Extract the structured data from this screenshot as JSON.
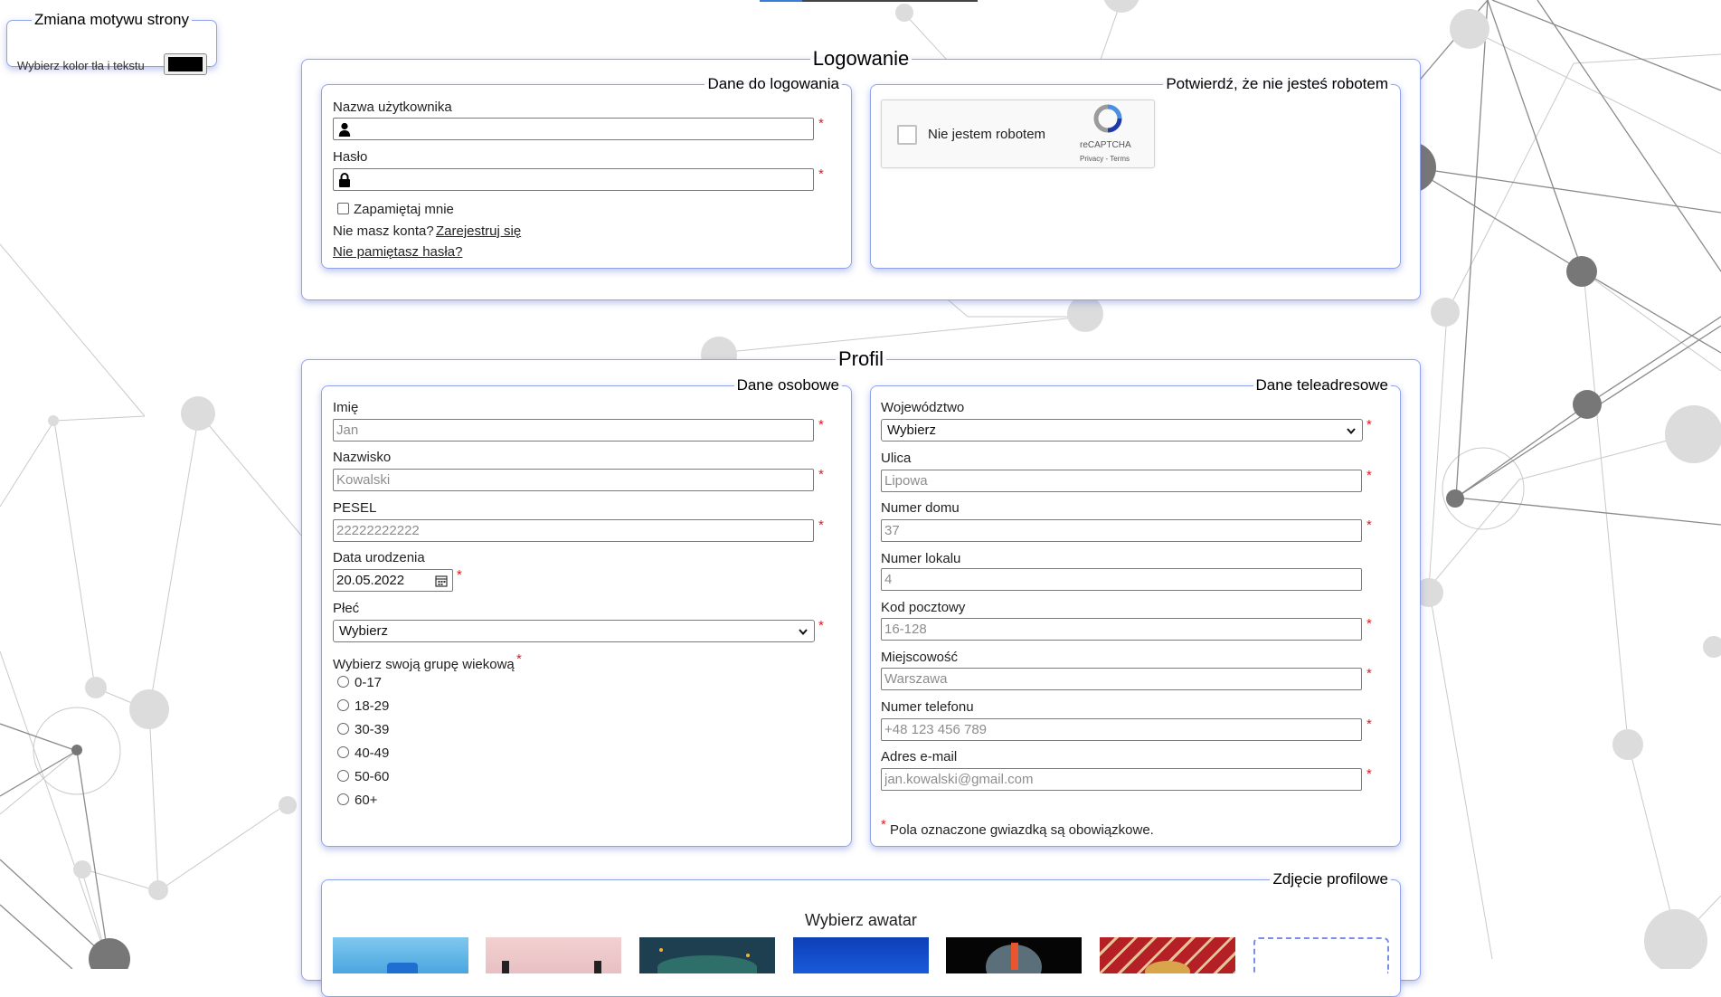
{
  "theme_box": {
    "legend": "Zmiana motywu strony",
    "label": "Wybierz kolor tła i tekstu",
    "swatch_color": "#000000"
  },
  "login": {
    "legend": "Logowanie",
    "credentials": {
      "legend": "Dane do logowania",
      "username_label": "Nazwa użytkownika",
      "password_label": "Hasło",
      "remember_label": "Zapamiętaj mnie",
      "no_account_text": "Nie masz konta?",
      "register_link": "Zarejestruj się",
      "forgot_link": "Nie pamiętasz hasła?"
    },
    "captcha": {
      "legend": "Potwierdź, że nie jesteś robotem",
      "checkbox_label": "Nie jestem robotem",
      "brand": "reCAPTCHA",
      "privacy": "Privacy",
      "separator": " - ",
      "terms": "Terms"
    }
  },
  "profile": {
    "legend": "Profil",
    "personal": {
      "legend": "Dane osobowe",
      "first_name_label": "Imię",
      "first_name_placeholder": "Jan",
      "last_name_label": "Nazwisko",
      "last_name_placeholder": "Kowalski",
      "pesel_label": "PESEL",
      "pesel_placeholder": "22222222222",
      "birth_label": "Data urodzenia",
      "birth_value": "20.05.2022",
      "gender_label": "Płeć",
      "gender_value": "Wybierz",
      "age_group_label": "Wybierz swoją grupę wiekową",
      "age_groups": [
        "0-17",
        "18-29",
        "30-39",
        "40-49",
        "50-60",
        "60+"
      ]
    },
    "contact": {
      "legend": "Dane teleadresowe",
      "voivodeship_label": "Województwo",
      "voivodeship_value": "Wybierz",
      "street_label": "Ulica",
      "street_placeholder": "Lipowa",
      "house_label": "Numer domu",
      "house_placeholder": "37",
      "flat_label": "Numer lokalu",
      "flat_placeholder": "4",
      "postal_label": "Kod pocztowy",
      "postal_placeholder": "16-128",
      "city_label": "Miejscowość",
      "city_placeholder": "Warszawa",
      "phone_label": "Numer telefonu",
      "phone_placeholder": "+48 123 456 789",
      "email_label": "Adres e-mail",
      "email_placeholder": "jan.kowalski@gmail.com",
      "required_note": "Pola oznaczone gwiazdką są obowiązkowe."
    },
    "photo": {
      "legend": "Zdjęcie profilowe",
      "title": "Wybierz awatar"
    }
  },
  "required_mark": "*",
  "colors": {
    "accent_border": "#8ea2ee",
    "required": "#e0191e",
    "background_network": "#9e9e9e"
  }
}
